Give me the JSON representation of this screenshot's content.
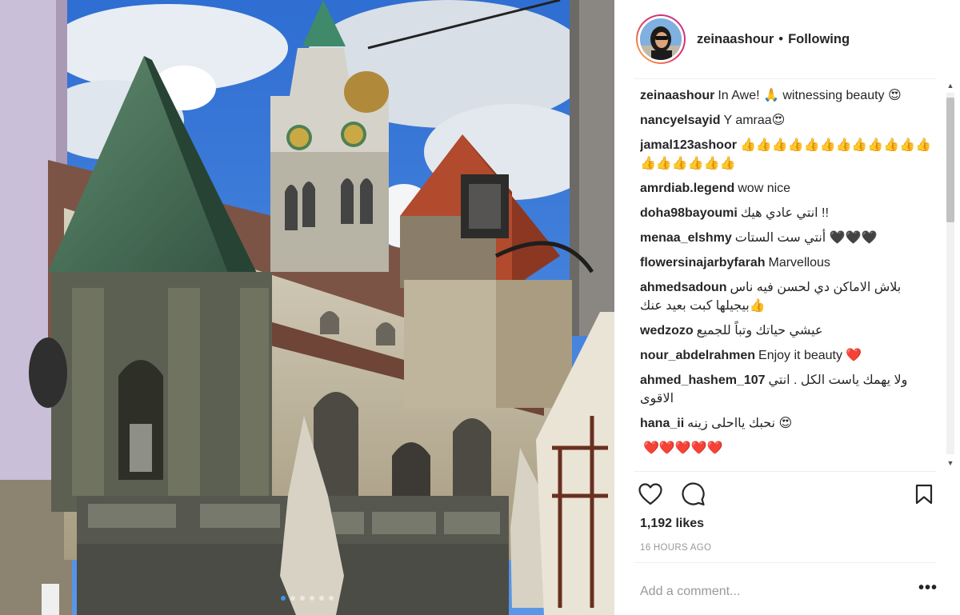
{
  "post": {
    "username": "zeinaashour",
    "separator": "•",
    "follow_status": "Following",
    "likes": "1,192 likes",
    "timestamp": "16 HOURS AGO",
    "comment_placeholder": "Add a comment...",
    "more_label": "•••",
    "carousel": {
      "count": 6,
      "active_index": 0
    }
  },
  "comments": [
    {
      "user": "zeinaashour",
      "text": "In Awe! 🙏 witnessing beauty 😍"
    },
    {
      "user": "nancyelsayid",
      "text": "Y amraa😍"
    },
    {
      "user": "jamal123ashoor",
      "text": "👍👍👍👍👍👍👍👍👍👍👍👍👍👍👍👍👍👍"
    },
    {
      "user": "amrdiab.legend",
      "text": "wow nice"
    },
    {
      "user": "doha98bayoumi",
      "text": "انتي عادي هيك !!"
    },
    {
      "user": "menaa_elshmy",
      "text": "أنتي ست الستات 🖤🖤🖤"
    },
    {
      "user": "flowersinajarbyfarah",
      "text": "Marvellous"
    },
    {
      "user": "ahmedsadoun",
      "text": "بلاش الاماكن دي لحسن فيه ناس بيجيلها كبت بعيد عنك👍"
    },
    {
      "user": "wedzozo",
      "text": "عيشي حياتك وتباً للجميع"
    },
    {
      "user": "nour_abdelrahmen",
      "text": "Enjoy it beauty ❤️"
    },
    {
      "user": "ahmed_hashem_107",
      "text": "ولا يهمك ياست الكل . انتي الاقوى"
    },
    {
      "user": "hana_ii",
      "text": "نحبك يااحلى زينه 😍"
    },
    {
      "user": "",
      "text": "❤️❤️❤️❤️❤️"
    }
  ],
  "icons": {
    "like": "heart-outline-icon",
    "comment": "comment-bubble-icon",
    "save": "bookmark-icon"
  },
  "colors": {
    "accent": "#3897f0",
    "text": "#262626",
    "muted": "#999999",
    "divider": "#efefef"
  }
}
